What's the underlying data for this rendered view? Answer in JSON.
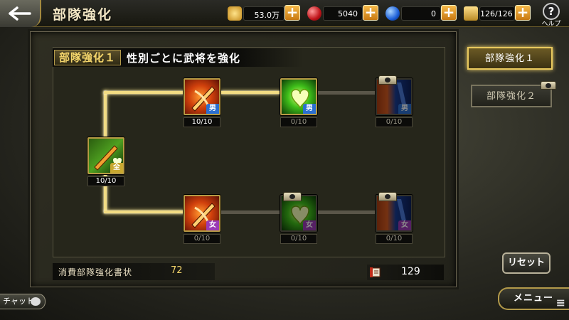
{
  "header": {
    "title": "部隊強化",
    "resources": [
      {
        "name": "gold",
        "value": "53.0万",
        "icon": "gold-coin-icon",
        "color": "#e8b93a"
      },
      {
        "name": "red_orb",
        "value": "5040",
        "icon": "red-orb-icon",
        "color": "#d8262b"
      },
      {
        "name": "blue_orb",
        "value": "0",
        "icon": "blue-orb-icon",
        "color": "#2a6ee0"
      },
      {
        "name": "stamina",
        "value": "126/126",
        "icon": "gold-bars-icon",
        "color": "#d9b24a"
      }
    ],
    "plus_label": "+",
    "help_label": "ヘルプ"
  },
  "section": {
    "badge": "部隊強化１",
    "description": "性別ごとに武将を強化"
  },
  "nodes": {
    "root": {
      "count": "10/10",
      "gender": "全",
      "icon": "sword-heart-icon"
    },
    "male": [
      {
        "count": "10/10",
        "gender": "男",
        "icon": "sword-icon"
      },
      {
        "count": "0/10",
        "gender": "男",
        "icon": "heart-icon"
      },
      {
        "count": "0/10",
        "gender": "男",
        "icon": "mixed-attack-icon"
      }
    ],
    "female": [
      {
        "count": "0/10",
        "gender": "女",
        "icon": "sword-icon"
      },
      {
        "count": "0/10",
        "gender": "女",
        "icon": "heart-icon"
      },
      {
        "count": "0/10",
        "gender": "女",
        "icon": "mixed-attack-icon"
      }
    ]
  },
  "footer": {
    "consume_label": "消費部隊強化書状",
    "consume_value": "72",
    "owned_value": "129"
  },
  "side": {
    "tab_active": "部隊強化１",
    "tab_inactive": "部隊強化２",
    "reset_label": "リセット"
  },
  "bottom": {
    "chat_label": "チャット",
    "menu_label": "メニュー",
    "menu_icon": "≡"
  }
}
